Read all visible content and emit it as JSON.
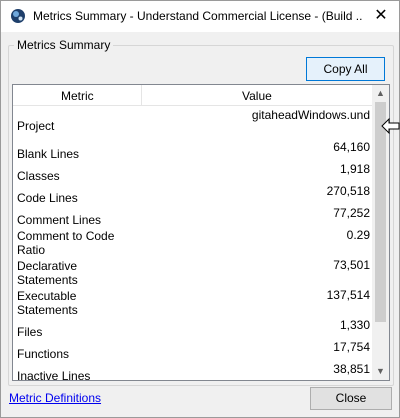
{
  "window": {
    "title": "Metrics Summary - Understand Commercial License - (Build ...",
    "close_glyph": "✕"
  },
  "group": {
    "label": "Metrics Summary",
    "copy_all": "Copy All"
  },
  "table": {
    "columns": [
      "Metric",
      "Value"
    ],
    "rows": [
      {
        "metric": "Project",
        "value": "gitaheadWindows.und"
      },
      {
        "metric": "Blank Lines",
        "value": "64,160"
      },
      {
        "metric": "Classes",
        "value": "1,918"
      },
      {
        "metric": "Code Lines",
        "value": "270,518"
      },
      {
        "metric": "Comment Lines",
        "value": "77,252"
      },
      {
        "metric": "Comment to Code Ratio",
        "metric_lines": [
          "Comment to Code",
          "Ratio"
        ],
        "value": "0.29"
      },
      {
        "metric": "Declarative Statements",
        "metric_lines": [
          "Declarative",
          "Statements"
        ],
        "value": "73,501"
      },
      {
        "metric": "Executable Statements",
        "metric_lines": [
          "Executable",
          "Statements"
        ],
        "value": "137,514"
      },
      {
        "metric": "Files",
        "value": "1,330"
      },
      {
        "metric": "Functions",
        "value": "17,754"
      },
      {
        "metric": "Inactive Lines",
        "value": "38,851"
      }
    ]
  },
  "footer": {
    "link": "Metric Definitions",
    "close": "Close"
  },
  "colors": {
    "link": "#0000ee",
    "accent_border": "#0078d7"
  },
  "icons": {
    "app": "understand-app-icon",
    "scroll_up": "▲",
    "scroll_down": "▼"
  }
}
